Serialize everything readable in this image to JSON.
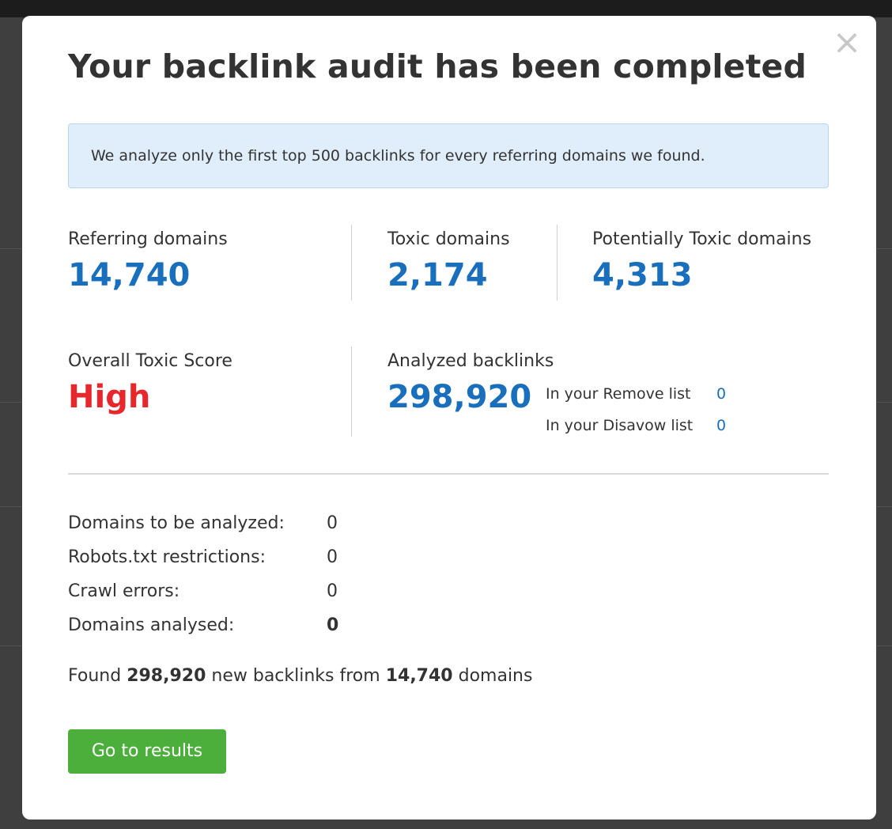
{
  "modal": {
    "title": "Your backlink audit has been completed",
    "close_symbol": "×",
    "notice": "We analyze only the first top 500 backlinks for every referring domains we found.",
    "stats": {
      "referring_domains": {
        "label": "Referring domains",
        "value": "14,740"
      },
      "toxic_domains": {
        "label": "Toxic domains",
        "value": "2,174"
      },
      "potentially_toxic_domains": {
        "label": "Potentially Toxic domains",
        "value": "4,313"
      },
      "overall_toxic_score": {
        "label": "Overall Toxic Score",
        "value": "High",
        "color": "#e8272c"
      },
      "analyzed_backlinks": {
        "label": "Analyzed backlinks",
        "value": "298,920",
        "remove_list": {
          "label": "In your Remove list",
          "value": "0"
        },
        "disavow_list": {
          "label": "In your Disavow list",
          "value": "0"
        }
      }
    },
    "counts": [
      {
        "label": "Domains to be analyzed:",
        "value": "0"
      },
      {
        "label": "Robots.txt restrictions:",
        "value": "0"
      },
      {
        "label": "Crawl errors:",
        "value": "0"
      },
      {
        "label": "Domains analysed:",
        "value": "0"
      }
    ],
    "found": {
      "prefix": "Found",
      "backlinks": "298,920",
      "middle": "new backlinks from",
      "domains": "14,740",
      "suffix": "domains"
    },
    "button_label": "Go to results"
  },
  "colors": {
    "accent_blue": "#1a6fbd",
    "toxic_red": "#e8272c",
    "button_green": "#4cae3b",
    "notice_bg": "#e0eefb"
  }
}
